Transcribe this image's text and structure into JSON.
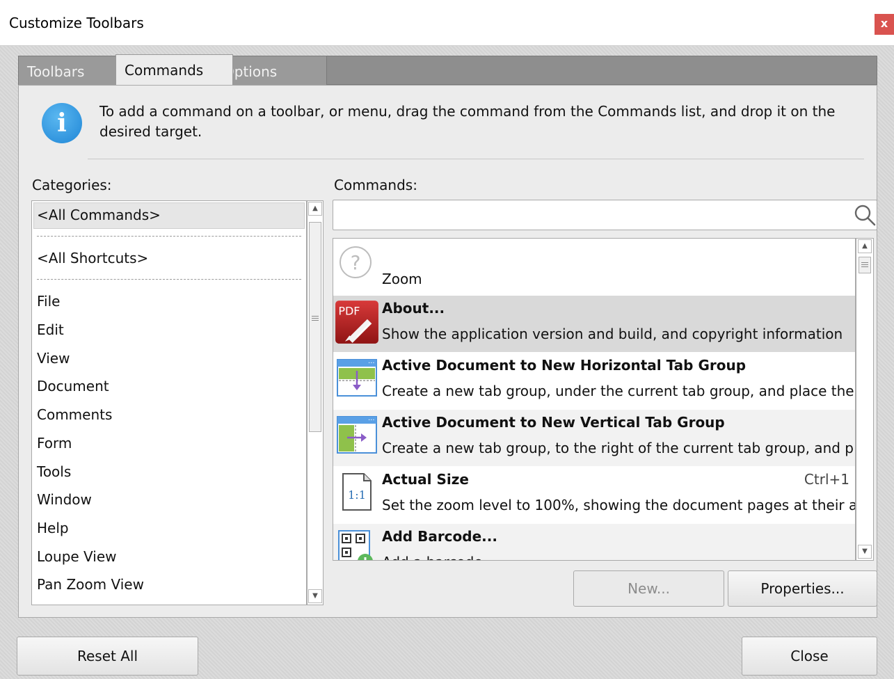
{
  "window": {
    "title": "Customize Toolbars",
    "close_glyph": "x",
    "close_color": "#d9534f"
  },
  "tabs": [
    {
      "label": "Toolbars",
      "active": false
    },
    {
      "label": "Commands",
      "active": true
    },
    {
      "label": "Options",
      "active": false
    }
  ],
  "info": {
    "icon": "info-icon",
    "icon_glyph": "i",
    "text": "To add a command on a toolbar, or menu, drag the command from the Commands list, and drop it on the desired target."
  },
  "categories": {
    "label": "Categories:",
    "selected": "<All Commands>",
    "shortcuts": "<All Shortcuts>",
    "items": [
      "File",
      "Edit",
      "View",
      "Document",
      "Comments",
      "Form",
      "Tools",
      "Window",
      "Help",
      "Loupe View",
      "Pan Zoom View"
    ]
  },
  "commands": {
    "label": "Commands:",
    "search": {
      "value": "",
      "placeholder": ""
    },
    "rows": [
      {
        "title": "",
        "description": "Zoom",
        "shortcut": "",
        "icon": "help-circle-icon"
      },
      {
        "title": "About...",
        "description": "Show the application version and build, and copyright information",
        "shortcut": "",
        "icon": "pdf-logo-icon",
        "selected": true
      },
      {
        "title": "Active Document to New Horizontal Tab Group",
        "description": "Create a new tab group, under the current tab group, and place the",
        "shortcut": "",
        "icon": "horizontal-tab-group-icon"
      },
      {
        "title": "Active Document to New Vertical Tab Group",
        "description": "Create a new tab group, to the right of the current tab group, and p",
        "shortcut": "",
        "icon": "vertical-tab-group-icon"
      },
      {
        "title": "Actual Size",
        "description": "Set the zoom level to 100%, showing the document pages at their a",
        "shortcut": "Ctrl+1",
        "icon": "actual-size-icon"
      },
      {
        "title": "Add Barcode...",
        "description": "Add a barcode",
        "shortcut": "",
        "icon": "add-barcode-icon"
      }
    ]
  },
  "buttons": {
    "new": "New...",
    "properties": "Properties...",
    "reset_all": "Reset All",
    "close": "Close"
  }
}
